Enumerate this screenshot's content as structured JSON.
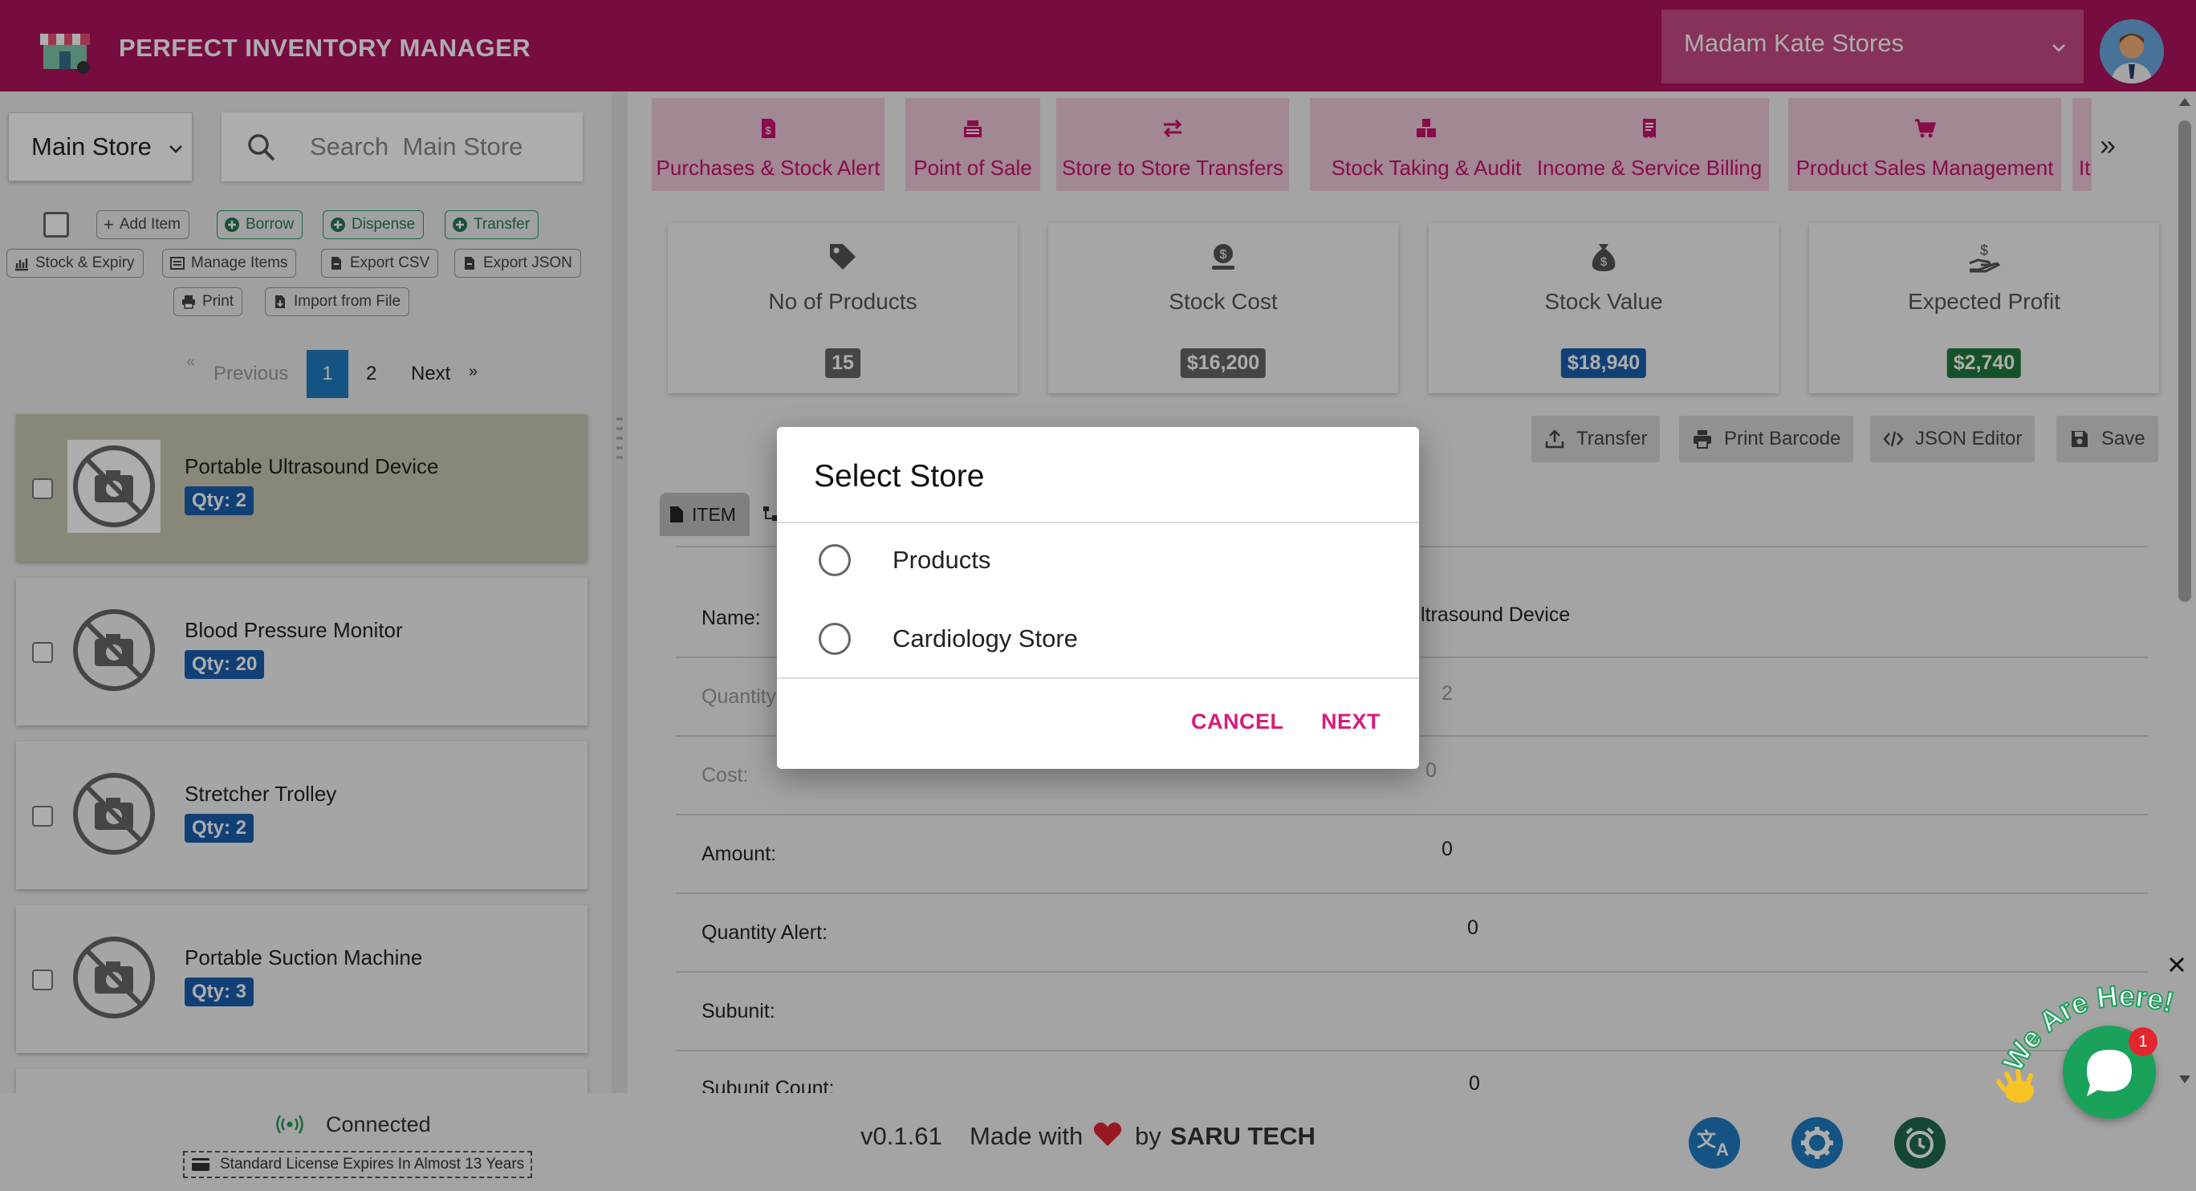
{
  "app": {
    "title": "PERFECT INVENTORY MANAGER",
    "store_selector": "Madam Kate Stores"
  },
  "left_panel": {
    "store_dropdown": "Main Store",
    "search_placeholder": "Search  Main Store",
    "toolbar": {
      "add_item": "Add Item",
      "borrow": "Borrow",
      "dispense": "Dispense",
      "transfer": "Transfer",
      "stock_expiry": "Stock & Expiry",
      "manage_items": "Manage Items",
      "export_csv": "Export CSV",
      "export_json": "Export JSON",
      "print": "Print",
      "import_file": "Import from File"
    },
    "pagination": {
      "previous": "Previous",
      "current": "1",
      "page2": "2",
      "next": "Next"
    },
    "items": [
      {
        "name": "Portable Ultrasound Device",
        "qty": "Qty: 2"
      },
      {
        "name": "Blood Pressure Monitor",
        "qty": "Qty: 20"
      },
      {
        "name": "Stretcher Trolley",
        "qty": "Qty: 2"
      },
      {
        "name": "Portable Suction Machine",
        "qty": "Qty: 3"
      }
    ]
  },
  "nav_tabs": [
    {
      "label": "Purchases & Stock Alert",
      "icon": "invoice-dollar-icon"
    },
    {
      "label": "Point of Sale",
      "icon": "cash-register-icon"
    },
    {
      "label": "Store to Store Transfers",
      "icon": "exchange-icon"
    },
    {
      "label": "Stock Taking & Audit",
      "icon": "boxes-icon"
    },
    {
      "label": "Income & Service Billing",
      "icon": "receipt-icon"
    },
    {
      "label": "Product Sales Management",
      "icon": "cart-icon"
    },
    {
      "label": "It",
      "icon": ""
    }
  ],
  "stats": [
    {
      "label": "No of Products",
      "value": "15",
      "color": "#666666",
      "icon": "tag-icon"
    },
    {
      "label": "Stock Cost",
      "value": "$16,200",
      "color": "#666666",
      "icon": "coin-stack-icon"
    },
    {
      "label": "Stock Value",
      "value": "$18,940",
      "color": "#1a5fb0",
      "icon": "money-bag-icon"
    },
    {
      "label": "Expected Profit",
      "value": "$2,740",
      "color": "#1f7a3a",
      "icon": "hand-dollar-icon"
    }
  ],
  "actions": {
    "transfer": "Transfer",
    "print_barcode": "Print Barcode",
    "json_editor": "JSON Editor",
    "save": "Save"
  },
  "item_tab": "ITEM",
  "details": {
    "name_label": "Name:",
    "name_value_visible": "ltrasound Device",
    "quantity_label": "Quantity",
    "quantity_value": "2",
    "cost_label": "Cost:",
    "cost_value": "0",
    "amount_label": "Amount:",
    "amount_value": "0",
    "qty_alert_label": "Quantity Alert:",
    "qty_alert_value": "0",
    "subunit_label": "Subunit:",
    "subunit_count_label": "Subunit Count:",
    "subunit_count_value": "0"
  },
  "footer": {
    "connection": "Connected",
    "license": "Standard License Expires In Almost 13 Years",
    "version": "v0.1.61",
    "made_with": "Made with",
    "by": "by",
    "brand": "SARU TECH"
  },
  "modal": {
    "title": "Select Store",
    "options": [
      "Products",
      "Cardiology Store"
    ],
    "cancel": "CANCEL",
    "next": "NEXT"
  },
  "chat": {
    "banner": "We Are Here!",
    "badge": "1"
  },
  "colors": {
    "brand": "#b0135f",
    "accent_pink": "#d81b7a",
    "tab_bg": "#efc8da",
    "chat_green": "#1aa25a",
    "fab_blue": "#1f7bc0"
  }
}
